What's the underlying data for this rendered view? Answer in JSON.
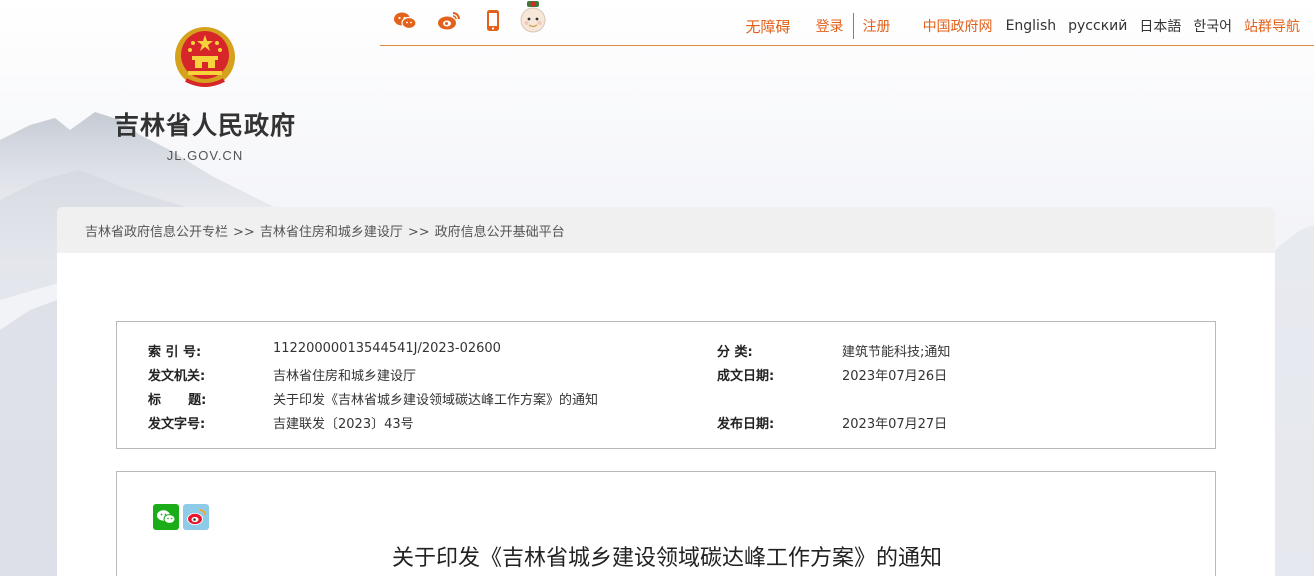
{
  "colors": {
    "accent": "#e2621b",
    "border": "#b9b9b9",
    "breadcrumb_bg": "#f0f0f0",
    "wechat": "#1aad19",
    "weibo": "#e6162d"
  },
  "header": {
    "share_icons": [
      "wechat-icon",
      "weibo-icon",
      "mobile-icon"
    ],
    "mascot": "mascot-icon",
    "links": {
      "accessible": "无障碍",
      "login": "登录",
      "register": "注册",
      "gov_net": "中国政府网",
      "english": "English",
      "russian": "русский",
      "japanese": "日本語",
      "korean": "한국어",
      "sitemap": "站群导航"
    }
  },
  "logo": {
    "name": "吉林省人民政府",
    "domain": "JL.GOV.CN",
    "emblem": "national-emblem-icon"
  },
  "breadcrumb": {
    "items": [
      "吉林省政府信息公开专栏",
      "吉林省住房和城乡建设厅",
      "政府信息公开基础平台"
    ],
    "separator": ">>"
  },
  "info": {
    "index_label": "索  引 号:",
    "index_value": "11220000013544541J/2023-02600",
    "category_label": "分  类:",
    "category_value": "建筑节能科技;通知",
    "issuer_label": "发文机关:",
    "issuer_value": "吉林省住房和城乡建设厅",
    "date_written_label": "成文日期:",
    "date_written_value": "2023年07月26日",
    "title_label": "标      题:",
    "title_value": "关于印发《吉林省城乡建设领域碳达峰工作方案》的通知",
    "doc_no_label": "发文字号:",
    "doc_no_value": "吉建联发〔2023〕43号",
    "publish_date_label": "发布日期:",
    "publish_date_value": "2023年07月27日"
  },
  "article": {
    "share_icons": [
      "wechat-share-icon",
      "weibo-share-icon"
    ],
    "title": "关于印发《吉林省城乡建设领域碳达峰工作方案》的通知"
  }
}
